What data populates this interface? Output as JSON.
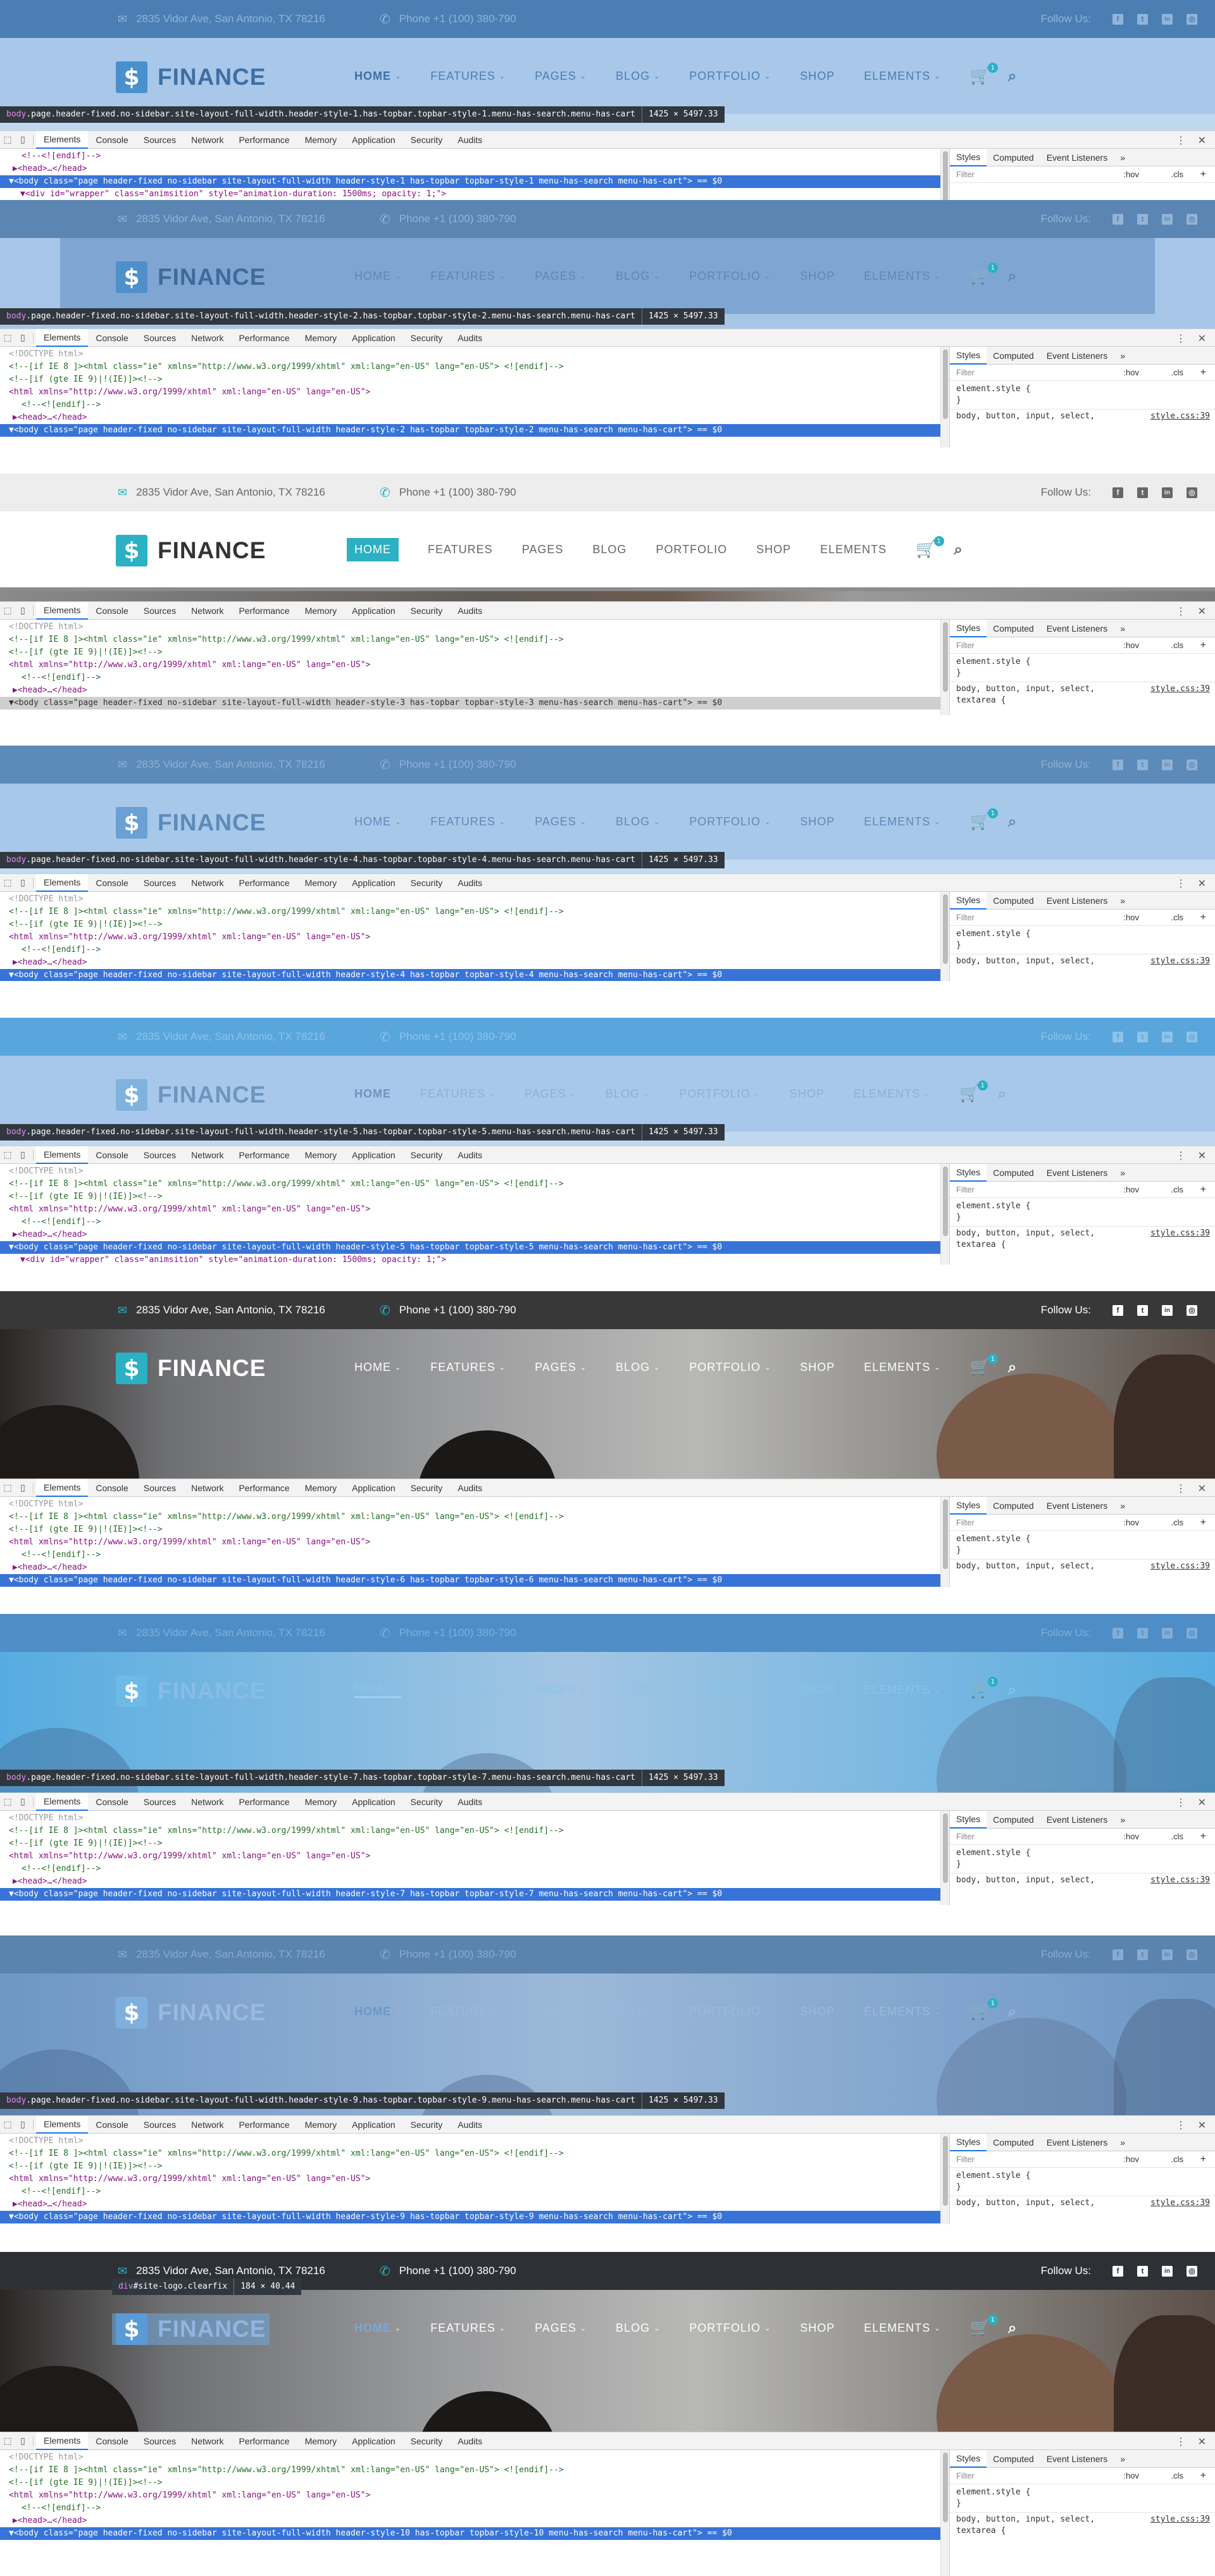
{
  "site": {
    "address": "2835 Vidor Ave, San Antonio, TX 78216",
    "phone": "Phone +1 (100) 380-790",
    "follow_us": "Follow Us:",
    "social_icons": [
      "facebook-icon",
      "twitter-icon",
      "linkedin-icon",
      "instagram-icon"
    ],
    "logo_text": "FINANCE",
    "logo_glyph": "$",
    "nav": [
      "HOME",
      "FEATURES",
      "PAGES",
      "BLOG",
      "PORTFOLIO",
      "SHOP",
      "ELEMENTS"
    ],
    "cart_count": "1",
    "accent_color": "#2bb0c4"
  },
  "devtools": {
    "tabs": [
      "Elements",
      "Console",
      "Sources",
      "Network",
      "Performance",
      "Memory",
      "Application",
      "Security",
      "Audits"
    ],
    "more": "»",
    "styles_tabs": [
      "Styles",
      "Computed",
      "Event Listeners"
    ],
    "filter_placeholder": "Filter",
    "hov": ":hov",
    "cls": ".cls",
    "plus": "+",
    "element_style": "element.style {",
    "close_brace": "}",
    "rule_selector": "body, button, input, select,",
    "rule_selector_more": "textarea {",
    "rule_source": "style.css:39",
    "doctype": "<!DOCTYPE html>",
    "line_ie8": "<!--[if IE 8 ]><html class=\"ie\" xmlns=\"http://www.w3.org/1999/xhtml\" xml:lang=\"en-US\" lang=\"en-US\"> <![endif]-->",
    "line_ie9": "<!--[if (gte IE 9)|!(IE)]><!-->",
    "line_html": "<html xmlns=\"http://www.w3.org/1999/xhtml\" xml:lang=\"en-US\" lang=\"en-US\">",
    "line_endif": "<!--<![endif]-->",
    "line_head": "▶<head>…</head>",
    "line_endif_partial": "<!--<![endif]-->",
    "line_wrapper": "▼<div id=\"wrapper\" class=\"animsition\" style=\"animation-duration: 1500ms; opacity: 1;\">"
  },
  "variants": [
    {
      "style_no": "1",
      "tooltip_tag": "body",
      "tooltip_class": ".page.header-fixed.no-sidebar.site-layout-full-width.header-style-1.has-topbar.topbar-style-1.menu-has-search.menu-has-cart",
      "tooltip_dims": "1425 × 5497.33",
      "body_line": "▼<body class=\"page header-fixed no-sidebar site-layout-full-width header-style-1 has-topbar topbar-style-1 menu-has-search menu-has-cart\"> == $0"
    },
    {
      "style_no": "2",
      "tooltip_tag": "body",
      "tooltip_class": ".page.header-fixed.no-sidebar.site-layout-full-width.header-style-2.has-topbar.topbar-style-2.menu-has-search.menu-has-cart",
      "tooltip_dims": "1425 × 5497.33",
      "body_line": "▼<body class=\"page header-fixed no-sidebar site-layout-full-width header-style-2 has-topbar topbar-style-2 menu-has-search menu-has-cart\"> == $0"
    },
    {
      "style_no": "3",
      "body_line": "▼<body class=\"page header-fixed no-sidebar site-layout-full-width header-style-3 has-topbar topbar-style-3 menu-has-search menu-has-cart\"> == $0"
    },
    {
      "style_no": "4",
      "tooltip_tag": "body",
      "tooltip_class": ".page.header-fixed.no-sidebar.site-layout-full-width.header-style-4.has-topbar.topbar-style-4.menu-has-search.menu-has-cart",
      "tooltip_dims": "1425 × 5497.33",
      "body_line": "▼<body class=\"page header-fixed no-sidebar site-layout-full-width header-style-4 has-topbar topbar-style-4 menu-has-search menu-has-cart\"> == $0"
    },
    {
      "style_no": "5",
      "tooltip_tag": "body",
      "tooltip_class": ".page.header-fixed.no-sidebar.site-layout-full-width.header-style-5.has-topbar.topbar-style-5.menu-has-search.menu-has-cart",
      "tooltip_dims": "1425 × 5497.33",
      "body_line": "▼<body class=\"page header-fixed no-sidebar site-layout-full-width header-style-5 has-topbar topbar-style-5 menu-has-search menu-has-cart\"> == $0"
    },
    {
      "style_no": "6",
      "body_line": "▼<body class=\"page header-fixed no-sidebar site-layout-full-width header-style-6 has-topbar topbar-style-6 menu-has-search menu-has-cart\"> == $0"
    },
    {
      "style_no": "7",
      "tooltip_tag": "body",
      "tooltip_class": ".page.header-fixed.no-sidebar.site-layout-full-width.header-style-7.has-topbar.topbar-style-7.menu-has-search.menu-has-cart",
      "tooltip_dims": "1425 × 5497.33",
      "body_line": "▼<body class=\"page header-fixed no-sidebar site-layout-full-width header-style-7 has-topbar topbar-style-7 menu-has-search menu-has-cart\"> == $0"
    },
    {
      "style_no": "9",
      "tooltip_tag": "body",
      "tooltip_class": ".page.header-fixed.no-sidebar.site-layout-full-width.header-style-9.has-topbar.topbar-style-9.menu-has-search.menu-has-cart",
      "tooltip_dims": "1425 × 5497.33",
      "body_line": "▼<body class=\"page header-fixed no-sidebar site-layout-full-width header-style-9 has-topbar topbar-style-9 menu-has-search menu-has-cart\"> == $0"
    },
    {
      "style_no": "10",
      "tooltip_tag": "div",
      "tooltip_class": "#site-logo.clearfix",
      "tooltip_dims": "184 × 40.44",
      "body_line": "▼<body class=\"page header-fixed no-sidebar site-layout-full-width header-style-10 has-topbar topbar-style-10 menu-has-search menu-has-cart\"> == $0"
    }
  ]
}
